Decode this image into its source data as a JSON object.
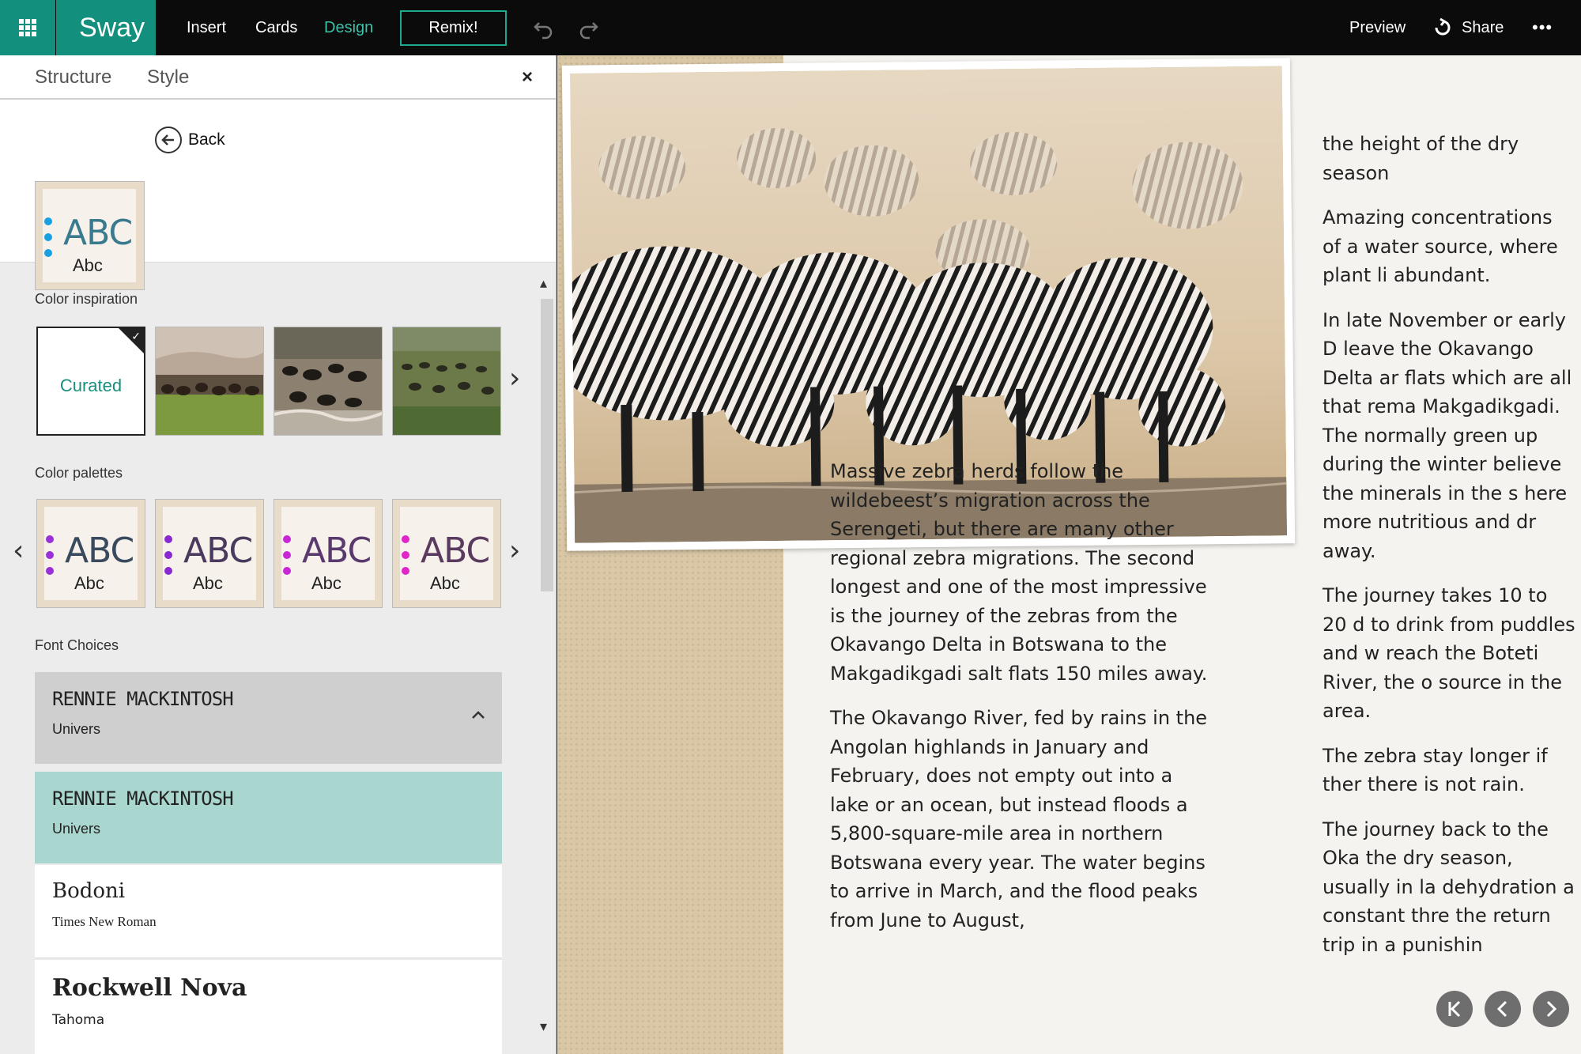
{
  "topbar": {
    "app_name": "Sway",
    "menu": [
      "Insert",
      "Cards",
      "Design"
    ],
    "remix_label": "Remix!",
    "preview_label": "Preview",
    "share_label": "Share",
    "more_label": "•••"
  },
  "pane": {
    "tabs": [
      "Structure",
      "Style"
    ],
    "close_label": "×",
    "back_label": "Back",
    "selected_style": {
      "big": "ABC",
      "small": "Abc"
    },
    "color_inspiration_label": "Color inspiration",
    "curated_label": "Curated",
    "color_palettes_label": "Color palettes",
    "palettes": [
      {
        "big": "ABC",
        "small": "Abc",
        "dot_color": "#9b30d8"
      },
      {
        "big": "ABC",
        "small": "Abc",
        "dot_color": "#8a28d0"
      },
      {
        "big": "ABC",
        "small": "Abc",
        "dot_color": "#c727d6"
      },
      {
        "big": "ABC",
        "small": "Abc",
        "dot_color": "#e026c8"
      }
    ],
    "font_choices_label": "Font Choices",
    "fonts": [
      {
        "primary": "RENNIE MACKINTOSH",
        "secondary": "Univers"
      },
      {
        "primary": "RENNIE MACKINTOSH",
        "secondary": "Univers"
      },
      {
        "primary": "Bodoni",
        "secondary": "Times New Roman"
      },
      {
        "primary": "Rockwell Nova",
        "secondary": "Tahoma"
      }
    ]
  },
  "content": {
    "col1": [
      "Massive zebra herds follow the wildebeest’s migration across the Serengeti, but there are many other regional zebra migrations. The second longest and one of the most impressive is the journey of the zebras from the Okavango Delta in Botswana to the Makgadikgadi salt flats 150 miles away.",
      "The Okavango River, fed by rains in the Angolan highlands in January and February, does not empty out into a lake or an ocean, but instead floods a 5,800-square-mile area in northern Botswana every year. The water begins to arrive in March, and the flood peaks from June to August,"
    ],
    "col2": [
      "the height of the dry season",
      "Amazing concentrations of a water source, where plant li abundant.",
      "In late November or early D leave the Okavango Delta ar flats which are all that rema Makgadikgadi. The normally green up during the winter believe the minerals in the s here more nutritious and dr away.",
      "The journey takes 10 to 20 d to drink from puddles and w reach the Boteti River, the o source in the area.",
      "The zebra stay longer if ther there is not rain.",
      "The journey back to the Oka the dry season, usually in la dehydration a constant thre the return trip in a punishin"
    ]
  },
  "colors": {
    "accent": "#128f7d",
    "accent_text": "#3cc2a8",
    "selected_font_bg": "#a9d6cf",
    "expanded_font_bg": "#cfcfcf",
    "topbar_bg": "#0b0b0b"
  }
}
